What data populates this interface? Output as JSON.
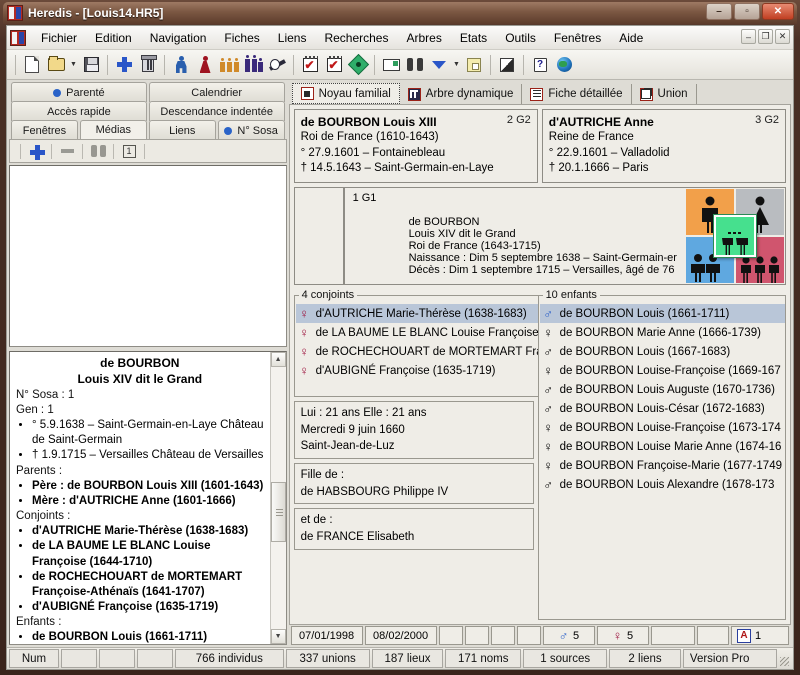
{
  "window": {
    "outer_title": "Heredis - [Louis14.HR5]",
    "minimize": "–",
    "maximize": "▫",
    "close": "✕",
    "inner_minimize": "–",
    "inner_restore": "❐",
    "inner_close": "✕"
  },
  "menu": {
    "items": [
      "Fichier",
      "Edition",
      "Navigation",
      "Fiches",
      "Liens",
      "Recherches",
      "Arbres",
      "Etats",
      "Outils",
      "Fenêtres",
      "Aide"
    ]
  },
  "toolbar": {
    "buttons": [
      {
        "name": "new-file",
        "icon": "document-icon"
      },
      {
        "name": "open-file",
        "icon": "folder-open-icon"
      },
      {
        "name": "open-dropdown",
        "icon": "chevron-down-icon"
      },
      {
        "name": "save-file",
        "icon": "floppy-disk-icon"
      },
      {
        "name": "add-record",
        "icon": "plus-icon"
      },
      {
        "name": "delete-record",
        "icon": "trash-icon"
      },
      {
        "name": "male-individual",
        "icon": "man-icon"
      },
      {
        "name": "female-individual",
        "icon": "woman-icon"
      },
      {
        "name": "siblings",
        "icon": "children-group-icon"
      },
      {
        "name": "family-group",
        "icon": "family-icon"
      },
      {
        "name": "unlink",
        "icon": "broken-link-icon"
      },
      {
        "name": "calendar-red",
        "icon": "calendar-check-icon"
      },
      {
        "name": "calendar-red-2",
        "icon": "calendar-check-icon"
      },
      {
        "name": "green-diamond",
        "icon": "diamond-icon"
      },
      {
        "name": "window-view",
        "icon": "window-icon"
      },
      {
        "name": "search",
        "icon": "binoculars-icon"
      },
      {
        "name": "search-down",
        "icon": "triangle-down-icon"
      },
      {
        "name": "search-menu",
        "icon": "chevron-down-icon"
      },
      {
        "name": "note",
        "icon": "sticky-note-icon"
      },
      {
        "name": "contrast",
        "icon": "half-tone-icon"
      },
      {
        "name": "help",
        "icon": "question-mark-icon"
      },
      {
        "name": "internet",
        "icon": "globe-icon"
      }
    ]
  },
  "left_panel": {
    "tab_rows": [
      [
        {
          "label": "Parenté",
          "dot": true
        },
        {
          "label": "Calendrier",
          "dot": false
        }
      ],
      [
        {
          "label": "Accès rapide",
          "dot": false
        },
        {
          "label": "Descendance indentée",
          "dot": false
        }
      ],
      [
        {
          "label": "Fenêtres",
          "dot": false
        },
        {
          "label": "Médias",
          "dot": false,
          "active": true
        },
        {
          "label": "Liens",
          "dot": false
        },
        {
          "label": "N° Sosa",
          "dot": true
        }
      ]
    ],
    "media_toolbar": [
      {
        "name": "add-media-button",
        "icon": "plus-icon"
      },
      {
        "name": "remove-media-button",
        "icon": "minus-icon"
      },
      {
        "name": "find-media-button",
        "icon": "binoculars-icon"
      },
      {
        "name": "media-count-button",
        "icon": "number-one-icon",
        "label": "1"
      }
    ]
  },
  "detail": {
    "surname": "de BOURBON",
    "given": "Louis XIV dit le Grand",
    "sosa": "N° Sosa : 1",
    "gen": "Gen : 1",
    "birth": "° 5.9.1638 – Saint-Germain-en-Laye Château de Saint-Germain",
    "death": "† 1.9.1715 – Versailles Château de Versailles",
    "parents_label": "Parents :",
    "father": "Père : de BOURBON Louis XIII (1601-1643)",
    "mother": "Mère : d'AUTRICHE Anne (1601-1666)",
    "spouses_label": "Conjoints :",
    "spouses": [
      "d'AUTRICHE Marie-Thérèse (1638-1683)",
      "de LA BAUME LE BLANC Louise Françoise (1644-1710)",
      "de ROCHECHOUART de MORTEMART Françoise-Athénaïs (1641-1707)",
      "d'AUBIGNÉ Françoise (1635-1719)"
    ],
    "children_label": "Enfants :",
    "children_first": "de BOURBON Louis (1661-1711)"
  },
  "right_tabs": [
    {
      "label": "Noyau familial",
      "icon": "square-frame-icon",
      "active": true
    },
    {
      "label": "Arbre dynamique",
      "icon": "tree-grid-icon",
      "active": false
    },
    {
      "label": "Fiche détaillée",
      "icon": "list-lines-icon",
      "active": false
    },
    {
      "label": "Union",
      "icon": "union-shapes-icon",
      "active": false
    }
  ],
  "father_card": {
    "gid": "2 G2",
    "name": "de BOURBON Louis XIII",
    "title": "Roi de France (1610-1643)",
    "birth": "° 27.9.1601 – Fontainebleau",
    "death": "† 14.5.1643 – Saint-Germain-en-Laye"
  },
  "mother_card": {
    "gid": "3 G2",
    "name": "d'AUTRICHE Anne",
    "title": "Reine de France",
    "birth": "° 22.9.1601 – Valladolid",
    "death": "† 20.1.1666 – Paris"
  },
  "center_card": {
    "gid": "1 G1",
    "surname": "de BOURBON",
    "given": "Louis XIV dit le Grand",
    "title": "Roi de France (1643-1715)",
    "birth": "Naissance : Dim 5 septembre 1638 – Saint-Germain-er",
    "death": "Décès : Dim 1 septembre 1715 – Versailles, âgé de 76",
    "nav_colors": {
      "father": "#f2a04a",
      "mother": "#b9bcc0",
      "siblings": "#5fa8e0",
      "children": "#d0556e",
      "center": "#46e08e"
    }
  },
  "spouses_box": {
    "legend": "4 conjoints",
    "items": [
      {
        "sex": "F",
        "text": "d'AUTRICHE Marie-Thérèse (1638-1683)",
        "selected": true
      },
      {
        "sex": "F",
        "text": "de LA BAUME LE BLANC Louise Françoise (",
        "selected": false
      },
      {
        "sex": "F",
        "text": "de ROCHECHOUART de MORTEMART Franço",
        "selected": false
      },
      {
        "sex": "F",
        "text": "d'AUBIGNÉ Françoise (1635-1719)",
        "selected": false
      }
    ]
  },
  "union_info": {
    "ages": "Lui : 21 ans Elle : 21 ans",
    "date": "Mercredi 9 juin 1660",
    "place": "Saint-Jean-de-Luz"
  },
  "spouse_father": {
    "label": "Fille de :",
    "name": "de HABSBOURG Philippe IV"
  },
  "spouse_mother": {
    "label": "et de :",
    "name": "de FRANCE Elisabeth"
  },
  "children_box": {
    "legend": "10 enfants",
    "items": [
      {
        "sex": "M",
        "text": "de BOURBON Louis (1661-1711)",
        "selected": true
      },
      {
        "sex": "F",
        "text": "de BOURBON Marie Anne (1666-1739)",
        "selected": false
      },
      {
        "sex": "M",
        "text": "de BOURBON Louis (1667-1683)",
        "selected": false
      },
      {
        "sex": "F",
        "text": "de BOURBON Louise-Françoise (1669-167",
        "selected": false
      },
      {
        "sex": "M",
        "text": "de BOURBON Louis Auguste (1670-1736)",
        "selected": false
      },
      {
        "sex": "M",
        "text": "de BOURBON Louis-César (1672-1683)",
        "selected": false
      },
      {
        "sex": "F",
        "text": "de BOURBON Louise-Françoise (1673-174",
        "selected": false
      },
      {
        "sex": "F",
        "text": "de BOURBON Louise Marie Anne (1674-16",
        "selected": false
      },
      {
        "sex": "F",
        "text": "de BOURBON Françoise-Marie (1677-1749",
        "selected": false
      },
      {
        "sex": "M",
        "text": "de BOURBON Louis Alexandre (1678-173",
        "selected": false
      }
    ]
  },
  "status_strip": {
    "date1": "07/01/1998",
    "date2": "08/02/2000",
    "male_count": "5",
    "female_count": "5",
    "male_symbol": "♂",
    "female_symbol": "♀",
    "badge_letter": "A",
    "badge_count": "1"
  },
  "bottom_bar": {
    "num": "Num",
    "individus": "766 individus",
    "unions": "337 unions",
    "lieux": "187 lieux",
    "noms": "171 noms",
    "sources": "1 sources",
    "liens": "2 liens",
    "version": "Version Pro"
  }
}
